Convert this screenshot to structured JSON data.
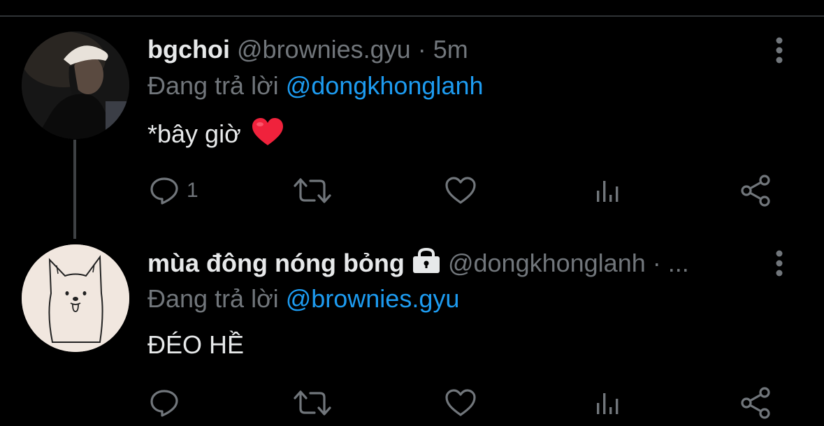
{
  "colors": {
    "background": "#000000",
    "text": "#e7e9ea",
    "muted": "#71767b",
    "link": "#1d9bf0",
    "heart": "#f0223c"
  },
  "tweets": [
    {
      "display_name": "bgchoi",
      "handle": "@brownies.gyu",
      "separator": "·",
      "time": "5m",
      "reply_prefix": "Đang trả lời",
      "reply_to": "@dongkhonglanh",
      "text": "*bây giờ",
      "emoji": "heart",
      "actions": {
        "reply_count": "1",
        "retweet_count": "",
        "like_count": ""
      },
      "avatar": "photo-avatar"
    },
    {
      "display_name": "mùa đông nóng bỏng",
      "locked": true,
      "handle": "@dongkhonglanh",
      "separator": "·",
      "time": "...",
      "reply_prefix": "Đang trả lời",
      "reply_to": "@brownies.gyu",
      "text": "ĐÉO HỀ",
      "actions": {
        "reply_count": "",
        "retweet_count": "",
        "like_count": ""
      },
      "avatar": "dog-drawing-avatar"
    }
  ],
  "icons": [
    "reply-icon",
    "retweet-icon",
    "like-icon",
    "analytics-icon",
    "share-icon",
    "more-icon",
    "lock-icon"
  ]
}
